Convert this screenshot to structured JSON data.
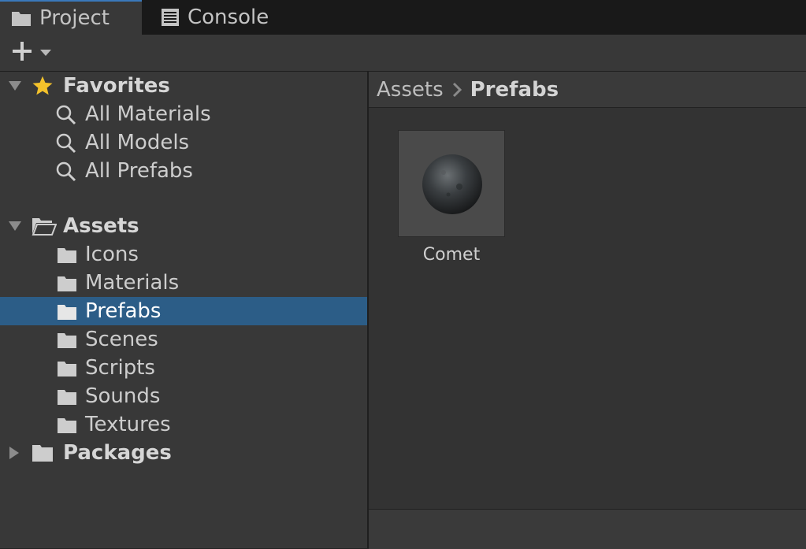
{
  "tabs": [
    {
      "label": "Project",
      "icon": "folder-icon",
      "active": true
    },
    {
      "label": "Console",
      "icon": "console-icon",
      "active": false
    }
  ],
  "toolbar": {
    "add_icon": "plus-icon",
    "dropdown_icon": "caret-down-icon"
  },
  "sidebar": {
    "favorites": {
      "label": "Favorites",
      "items": [
        {
          "label": "All Materials"
        },
        {
          "label": "All Models"
        },
        {
          "label": "All Prefabs"
        }
      ]
    },
    "assets": {
      "label": "Assets",
      "items": [
        {
          "label": "Icons"
        },
        {
          "label": "Materials"
        },
        {
          "label": "Prefabs",
          "selected": true
        },
        {
          "label": "Scenes"
        },
        {
          "label": "Scripts"
        },
        {
          "label": "Sounds"
        },
        {
          "label": "Textures"
        }
      ]
    },
    "packages": {
      "label": "Packages"
    }
  },
  "breadcrumb": [
    "Assets",
    "Prefabs"
  ],
  "content": {
    "items": [
      {
        "label": "Comet",
        "icon": "sphere-prefab-icon"
      }
    ]
  },
  "colors": {
    "selection": "#2c5d87",
    "accent": "#3a79bb",
    "star": "#f4c22b"
  }
}
